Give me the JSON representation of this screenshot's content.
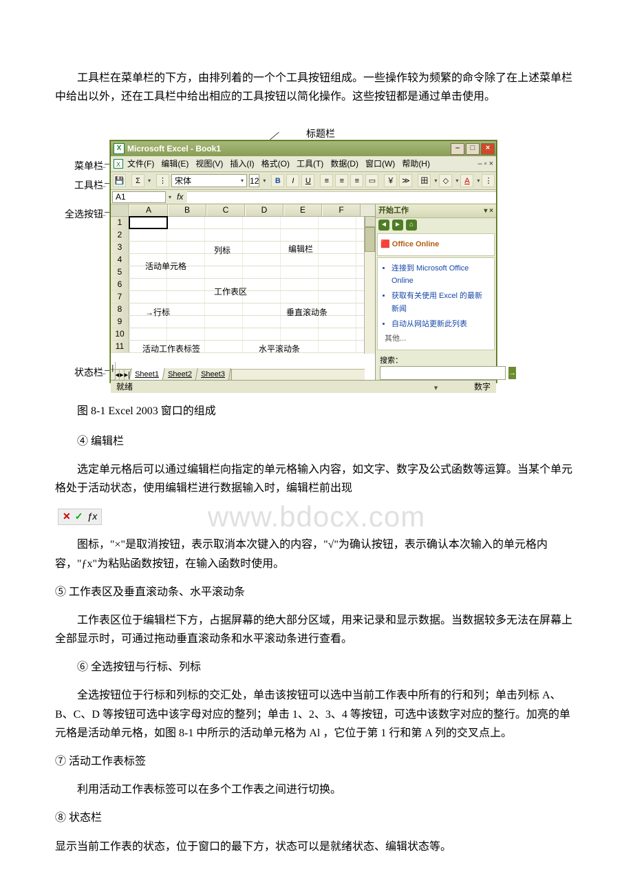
{
  "paragraphs": {
    "p1": "工具栏在菜单栏的下方，由排列着的一个个工具按钮组成。一些操作较为频繁的命令除了在上述菜单栏中给出以外，还在工具栏中给出相应的工具按钮以简化操作。这些按钮都是通过单击使用。",
    "caption": "图 8-1 Excel 2003 窗口的组成",
    "h4": "④ 编辑栏",
    "p4": "选定单元格后可以通过编辑栏向指定的单元格输入内容，如文字、数字及公式函数等运算。当某个单元格处于活动状态，使用编辑栏进行数据输入时，编辑栏前出现",
    "p4b": "图标，\"×\"是取消按钮，表示取消本次键入的内容，\"√\"为确认按钮，表示确认本次输入的单元格内容，\"ƒx\"为粘贴函数按钮，在输入函数时使用。",
    "h5": "⑤ 工作表区及垂直滚动条、水平滚动条",
    "p5": "工作表区位于编辑栏下方，占据屏幕的绝大部分区域，用来记录和显示数据。当数据较多无法在屏幕上全部显示时，可通过拖动垂直滚动条和水平滚动条进行查看。",
    "h6": "⑥ 全选按钮与行标、列标",
    "p6": "全选按钮位于行标和列标的交汇处，单击该按钮可以选中当前工作表中所有的行和列；单击列标 A、B、C、D 等按钮可选中该字母对应的整列；单击 1、2、3、4 等按钮，可选中该数字对应的整行。加亮的单元格是活动单元格，如图 8-1 中所示的活动单元格为 Al ，它位于第 1 行和第 A 列的交叉点上。",
    "h7": "⑦ 活动工作表标签",
    "p7": "利用活动工作表标签可以在多个工作表之间进行切换。",
    "h8": "⑧ 状态栏",
    "p8": "显示当前工作表的状态，位于窗口的最下方，状态可以是就绪状态、编辑状态等。"
  },
  "diagram_labels": {
    "titlebar_label": "标题栏",
    "menubar_label": "菜单栏",
    "toolbar_label": "工具栏",
    "allsel_label": "全选按钮",
    "status_label": "状态栏",
    "colhead_label": "列标",
    "editbar_label": "编辑栏",
    "activecell_label": "活动单元格",
    "workarea_label": "工作表区",
    "vscroll_label": "垂直滚动条",
    "rowhead_label": "行标",
    "activesheet_label": "活动工作表标签",
    "hscroll_label": "水平滚动条"
  },
  "excel": {
    "title": "Microsoft Excel - Book1",
    "menu": {
      "file": "文件(F)",
      "edit": "编辑(E)",
      "view": "视图(V)",
      "insert": "插入(I)",
      "format": "格式(O)",
      "tools": "工具(T)",
      "data": "数据(D)",
      "window": "窗口(W)",
      "help": "帮助(H)"
    },
    "font_name": "宋体",
    "font_size": "12",
    "namebox": "A1",
    "fx": "fx",
    "columns": [
      "A",
      "B",
      "C",
      "D",
      "E",
      "F"
    ],
    "rows": [
      "1",
      "2",
      "3",
      "4",
      "5",
      "6",
      "7",
      "8",
      "9",
      "10",
      "11"
    ],
    "tabs": [
      "Sheet1",
      "Sheet2",
      "Sheet3"
    ],
    "status_ready": "就绪",
    "status_num": "数字",
    "taskpane": {
      "title": "开始工作",
      "office_online": "Office Online",
      "link1": "连接到 Microsoft Office Online",
      "link2": "获取有关使用 Excel 的最新新闻",
      "link3": "自动从网站更新此列表",
      "other": "其他...",
      "search_label": "搜索："
    }
  },
  "watermark": "www.bdocx.com"
}
